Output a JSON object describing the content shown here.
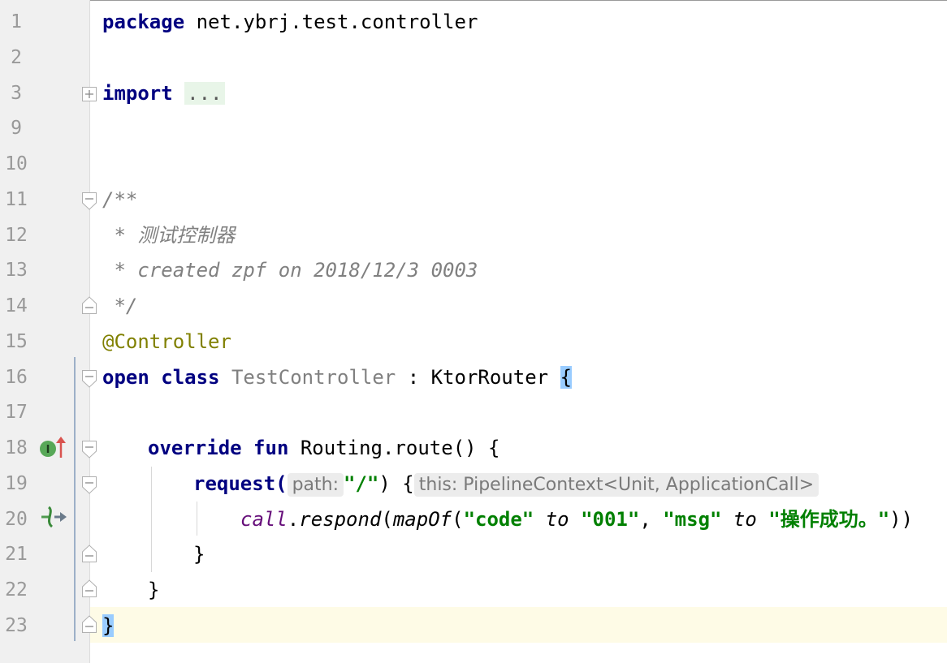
{
  "editor": {
    "lines": [
      {
        "num": "1"
      },
      {
        "num": "2"
      },
      {
        "num": "3"
      },
      {
        "num": "9"
      },
      {
        "num": "10"
      },
      {
        "num": "11"
      },
      {
        "num": "12"
      },
      {
        "num": "13"
      },
      {
        "num": "14"
      },
      {
        "num": "15"
      },
      {
        "num": "16"
      },
      {
        "num": "17"
      },
      {
        "num": "18"
      },
      {
        "num": "19"
      },
      {
        "num": "20"
      },
      {
        "num": "21"
      },
      {
        "num": "22"
      },
      {
        "num": "23"
      }
    ],
    "code": {
      "l1_kw": "package",
      "l1_rest": " net.ybrj.test.controller",
      "l3_kw": "import",
      "l3_fold": "...",
      "l11": "/**",
      "l12": " * 测试控制器",
      "l13": " * created zpf on 2018/12/3 0003",
      "l14": " */",
      "l15": "@Controller",
      "l16_kw1": "open",
      "l16_kw2": "class",
      "l16_name": "TestController",
      "l16_colon": " : ",
      "l16_type": "KtorRouter",
      "l16_brace": "{",
      "l18_kw1": "override",
      "l18_kw2": "fun",
      "l18_rest": "Routing.route() {",
      "l19_fn": "request(",
      "l19_hint1": "path:",
      "l19_str": "\"/\"",
      "l19_close": ") {",
      "l19_hint2": "this: PipelineContext<Unit, ApplicationCall>",
      "l20_call": "call",
      "l20_dot": ".",
      "l20_respond": "respond",
      "l20_open": "(",
      "l20_mapof": "mapOf",
      "l20_open2": "(",
      "l20_s1": "\"code\"",
      "l20_to1": " to ",
      "l20_s2": "\"001\"",
      "l20_comma": ", ",
      "l20_s3": "\"msg\"",
      "l20_to2": " to ",
      "l20_s4": "\"操作成功。\"",
      "l20_close": "))",
      "l21": "}",
      "l22": "}",
      "l23": "}"
    },
    "gutter_icons": {
      "line18": "implements-override-icon",
      "line20": "route-navigation-icon"
    },
    "colors": {
      "keyword": "#000080",
      "string": "#008000",
      "comment": "#808080",
      "annotation": "#808000",
      "current_line": "#fefbe6"
    }
  }
}
